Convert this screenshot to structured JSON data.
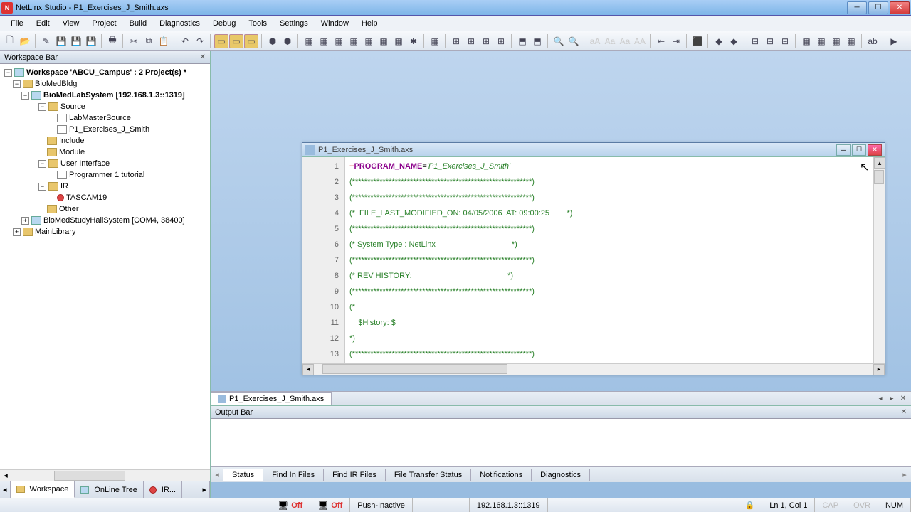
{
  "window": {
    "title": "NetLinx Studio - P1_Exercises_J_Smith.axs"
  },
  "menu": [
    "File",
    "Edit",
    "View",
    "Project",
    "Build",
    "Diagnostics",
    "Debug",
    "Tools",
    "Settings",
    "Window",
    "Help"
  ],
  "workspace_bar": {
    "title": "Workspace Bar"
  },
  "tree": {
    "root": "Workspace 'ABCU_Campus' : 2 Project(s) *",
    "n0": "BioMedBldg",
    "n1": "BioMedLabSystem [192.168.1.3::1319]",
    "n2": "Source",
    "n2a": "LabMasterSource",
    "n2b": "P1_Exercises_J_Smith",
    "n3": "Include",
    "n4": "Module",
    "n5": "User Interface",
    "n5a": "Programmer 1 tutorial",
    "n6": "IR",
    "n6a": "TASCAM19",
    "n6b": "Other",
    "n7": "BioMedStudyHallSystem [COM4, 38400]",
    "n8": "MainLibrary"
  },
  "left_tabs": {
    "a": "Workspace",
    "b": "OnLine Tree",
    "c": "IR..."
  },
  "editor": {
    "title": "P1_Exercises_J_Smith.axs",
    "lines": [
      "1",
      "2",
      "3",
      "4",
      "5",
      "6",
      "7",
      "8",
      "9",
      "10",
      "11",
      "12",
      "13"
    ],
    "l1a": "PROGRAM_NAME",
    "l1b": "=",
    "l1c": "'P1_Exercises_J_Smith'",
    "stars": "(***********************************************************)",
    "l4": "(*  FILE_LAST_MODIFIED_ON: 04/05/2006  AT: 09:00:25        *)",
    "l6": "(* System Type : NetLinx                                   *)",
    "l8": "(* REV HISTORY:                                            *)",
    "l10": "(*",
    "l11": "    $History: $",
    "l12": "*)"
  },
  "doc_tab": "P1_Exercises_J_Smith.axs",
  "output_bar": {
    "title": "Output Bar"
  },
  "output_tabs": [
    "Status",
    "Find In Files",
    "Find IR Files",
    "File Transfer Status",
    "Notifications",
    "Diagnostics"
  ],
  "status": {
    "off": "Off",
    "push": "Push-Inactive",
    "ip": "192.168.1.3::1319",
    "pos": "Ln     1, Col   1",
    "cap": "CAP",
    "ovr": "OVR",
    "num": "NUM"
  }
}
